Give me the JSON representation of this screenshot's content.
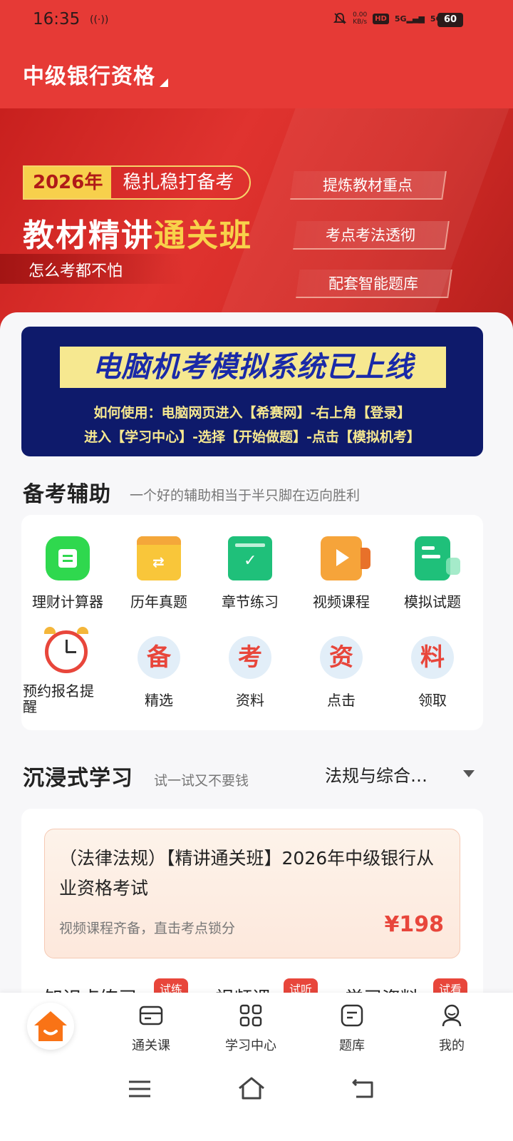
{
  "status": {
    "time": "16:35",
    "speed_top": "0.00",
    "speed_bottom": "KB/s",
    "hd": "HD",
    "net1": "5G",
    "net2": "5G",
    "battery": "60"
  },
  "header": {
    "title": "中级银行资格"
  },
  "banner": {
    "year": "2026年",
    "slogan": "稳扎稳打备考",
    "main_prefix": "教材精讲",
    "main_highlight": "通关班",
    "sub": "怎么考都不怕",
    "features": [
      "提炼教材重点",
      "考点考法透彻",
      "配套智能题库"
    ]
  },
  "notice": {
    "title": "电脑机考模拟系统已上线",
    "line1": "如何使用：电脑网页进入【希赛网】-右上角【登录】",
    "line2": "进入【学习中心】-选择【开始做题】-点击【模拟机考】"
  },
  "aids": {
    "title": "备考辅助",
    "subtitle": "一个好的辅助相当于半只脚在迈向胜利",
    "tools": [
      {
        "label": "理财计算器",
        "icon": "calculator-icon"
      },
      {
        "label": "历年真题",
        "icon": "book-icon"
      },
      {
        "label": "章节练习",
        "icon": "check-card-icon"
      },
      {
        "label": "视频课程",
        "icon": "video-icon"
      },
      {
        "label": "模拟试题",
        "icon": "test-paper-icon"
      },
      {
        "label": "预约报名提醒",
        "icon": "alarm-clock-icon"
      },
      {
        "label": "精选",
        "char": "备"
      },
      {
        "label": "资料",
        "char": "考"
      },
      {
        "label": "点击",
        "char": "资"
      },
      {
        "label": "领取",
        "char": "料"
      }
    ]
  },
  "immersive": {
    "title": "沉浸式学习",
    "subtitle": "试一试又不要钱",
    "select": "法规与综合…"
  },
  "course": {
    "title": "（法律法规）【精讲通关班】2026年中级银行从业资格考试",
    "desc": "视频课程齐备，直击考点锁分",
    "price": "¥198"
  },
  "peek_tabs": [
    {
      "label": "知识点练习",
      "badge": "试练"
    },
    {
      "label": "视频课",
      "badge": "试听"
    },
    {
      "label": "学习资料",
      "badge": "试看"
    }
  ],
  "nav": {
    "items": [
      "通关课",
      "学习中心",
      "题库",
      "我的"
    ]
  },
  "colors": {
    "primary_red": "#e63a36",
    "notice_bg": "#0e1a6b",
    "price_red": "#e8463b"
  }
}
